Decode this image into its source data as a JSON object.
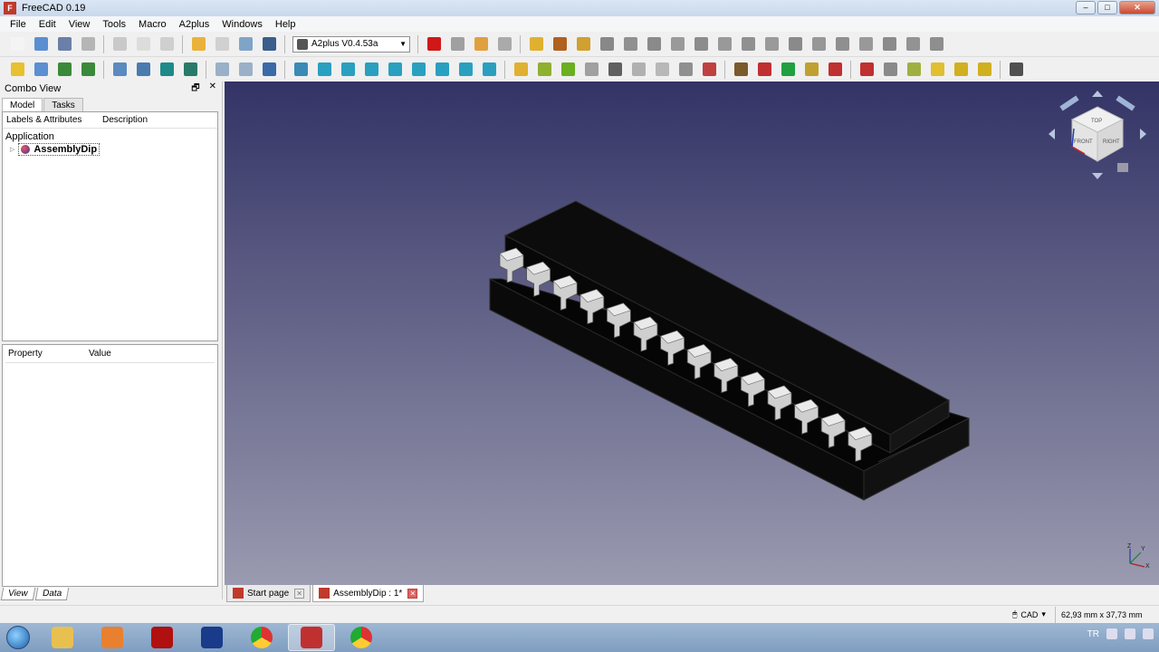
{
  "window": {
    "title": "FreeCAD 0.19",
    "min": "–",
    "max": "□",
    "close": "✕"
  },
  "menu": [
    "File",
    "Edit",
    "View",
    "Tools",
    "Macro",
    "A2plus",
    "Windows",
    "Help"
  ],
  "workbench_selector": {
    "value": "A2plus V0.4.53a"
  },
  "toolbar1_icons": [
    {
      "name": "new-document-icon",
      "color": "#f4f4f4"
    },
    {
      "name": "open-icon",
      "color": "#5b8fd1"
    },
    {
      "name": "save-icon",
      "color": "#6b7fa8"
    },
    {
      "name": "print-icon",
      "color": "#b5b5b5"
    },
    {
      "sep": true
    },
    {
      "name": "cut-icon",
      "color": "#c9c9c9"
    },
    {
      "name": "copy-icon",
      "color": "#dcdcdc"
    },
    {
      "name": "paste-icon",
      "color": "#cfcfcf"
    },
    {
      "sep": true
    },
    {
      "name": "undo-icon",
      "color": "#e9b23a"
    },
    {
      "name": "redo-icon",
      "color": "#d0d0d0"
    },
    {
      "name": "refresh-icon",
      "color": "#7fa4c8"
    },
    {
      "name": "whats-this-icon",
      "color": "#3a5d8a"
    },
    {
      "sep": true
    },
    {
      "wb": true
    },
    {
      "sep": true
    },
    {
      "name": "macro-record-icon",
      "color": "#d01818"
    },
    {
      "name": "macro-stop-icon",
      "color": "#a0a0a0"
    },
    {
      "name": "macro-edit-icon",
      "color": "#e0a040"
    },
    {
      "name": "macro-run-icon",
      "color": "#aaaaaa"
    },
    {
      "sep": true
    },
    {
      "name": "a2p-add-part-icon",
      "color": "#e0b030"
    },
    {
      "name": "a2p-import-icon",
      "color": "#b06020"
    },
    {
      "name": "a2p-shape-icon",
      "color": "#d0a030"
    },
    {
      "name": "a2p-delete-icon",
      "color": "#888888"
    },
    {
      "name": "point-constraint-icon",
      "color": "#909090"
    },
    {
      "name": "point-on-line-icon",
      "color": "#8a8a8a"
    },
    {
      "name": "point-on-plane-icon",
      "color": "#9a9a9a"
    },
    {
      "name": "sphere-constraint-icon",
      "color": "#8c8c8c"
    },
    {
      "name": "circular-edge-icon",
      "color": "#999999"
    },
    {
      "name": "axial-constraint-icon",
      "color": "#909090"
    },
    {
      "name": "axis-parallel-icon",
      "color": "#9a9a9a"
    },
    {
      "name": "angled-planes-icon",
      "color": "#8a8a8a"
    },
    {
      "name": "plane-parallel-icon",
      "color": "#979797"
    },
    {
      "name": "plane-coincident-icon",
      "color": "#8f8f8f"
    },
    {
      "name": "angle-constraint-icon",
      "color": "#999999"
    },
    {
      "name": "center-of-mass-icon",
      "color": "#8b8b8b"
    },
    {
      "name": "lock-constraint-icon",
      "color": "#939393"
    },
    {
      "name": "edit-constraint-icon",
      "color": "#8e8e8e"
    }
  ],
  "toolbar2_icons": [
    {
      "name": "part-yellow-icon",
      "color": "#e8c030"
    },
    {
      "name": "folder-icon",
      "color": "#5b8fd1"
    },
    {
      "name": "link-icon",
      "color": "#3a8a3a"
    },
    {
      "name": "link-group-icon",
      "color": "#3a8a3a"
    },
    {
      "sep": true
    },
    {
      "name": "fit-all-icon",
      "color": "#5a8ac0"
    },
    {
      "name": "fit-selection-icon",
      "color": "#4a7ab0"
    },
    {
      "name": "draw-style-icon",
      "color": "#1f8a8a"
    },
    {
      "name": "bounding-box-icon",
      "color": "#2a7a6a"
    },
    {
      "sep": true
    },
    {
      "name": "back-icon",
      "color": "#9ab0c8"
    },
    {
      "name": "forward-icon",
      "color": "#9ab0c8"
    },
    {
      "name": "std-view-icon",
      "color": "#3a6aa8"
    },
    {
      "sep": true
    },
    {
      "name": "zoom-box-icon",
      "color": "#3a8ab8"
    },
    {
      "name": "isometric-icon",
      "color": "#2aa0c0"
    },
    {
      "name": "front-view-icon",
      "color": "#2aa0c0"
    },
    {
      "name": "top-view-icon",
      "color": "#2aa0c0"
    },
    {
      "name": "right-view-icon",
      "color": "#2aa0c0"
    },
    {
      "name": "rear-view-icon",
      "color": "#2aa0c0"
    },
    {
      "name": "bottom-view-icon",
      "color": "#2aa0c0"
    },
    {
      "name": "left-view-icon",
      "color": "#2aa0c0"
    },
    {
      "name": "measure-icon",
      "color": "#2aa0c0"
    },
    {
      "sep": true
    },
    {
      "name": "a2p-solve-icon",
      "color": "#e0b030"
    },
    {
      "name": "a2p-update-icon",
      "color": "#90b030"
    },
    {
      "name": "a2p-recompute-icon",
      "color": "#6ab020"
    },
    {
      "name": "a2p-move-icon",
      "color": "#a0a0a0"
    },
    {
      "name": "a2p-duplicate-icon",
      "color": "#606060"
    },
    {
      "name": "a2p-convert-icon",
      "color": "#b0b0b0"
    },
    {
      "name": "a2p-transparency-icon",
      "color": "#b8b8b8"
    },
    {
      "name": "a2p-partlist-icon",
      "color": "#909090"
    },
    {
      "name": "a2p-export-icon",
      "color": "#c04040"
    },
    {
      "sep": true
    },
    {
      "name": "a2p-mirror-icon",
      "color": "#7a5a2a"
    },
    {
      "name": "a2p-autosolve-icon",
      "color": "#c03030"
    },
    {
      "name": "a2p-flip-icon",
      "color": "#20a040"
    },
    {
      "name": "a2p-list-icon",
      "color": "#c0a030"
    },
    {
      "name": "a2p-tools-icon",
      "color": "#c03030"
    },
    {
      "sep": true
    },
    {
      "name": "a2p-cleanup-icon",
      "color": "#c03030"
    },
    {
      "name": "a2p-search-icon",
      "color": "#8a8a8a"
    },
    {
      "name": "a2p-bom-icon",
      "color": "#a0b040"
    },
    {
      "name": "a2p-cd-icon",
      "color": "#e0c030"
    },
    {
      "name": "a2p-label-icon",
      "color": "#d0b020"
    },
    {
      "name": "a2p-shape-ref-icon",
      "color": "#d0b020"
    },
    {
      "sep": true
    },
    {
      "name": "a2p-debug-icon",
      "color": "#505050"
    }
  ],
  "combo_view": {
    "title": "Combo View",
    "float_btn": "🗗",
    "close_btn": "✕",
    "tabs": [
      "Model",
      "Tasks"
    ],
    "tree_columns": [
      "Labels & Attributes",
      "Description"
    ],
    "tree_root": "Application",
    "tree_item": "AssemblyDip",
    "prop_columns": [
      "Property",
      "Value"
    ],
    "bottom_tabs": [
      "View",
      "Data"
    ]
  },
  "navcube": {
    "faces": [
      "TOP",
      "FRONT",
      "RIGHT"
    ]
  },
  "axis": {
    "x": "X",
    "y": "Y",
    "z": "Z"
  },
  "doc_tabs": [
    {
      "label": "Start page"
    },
    {
      "label": "AssemblyDip : 1*"
    }
  ],
  "status": {
    "nav_mode": "CAD",
    "dims": "62,93 mm x 37,73 mm"
  },
  "taskbar": {
    "apps": [
      {
        "name": "explorer-icon",
        "color": "#e8c050"
      },
      {
        "name": "media-player-icon",
        "color": "#e88030"
      },
      {
        "name": "sketch-app-icon",
        "color": "#b01010"
      },
      {
        "name": "ccleaner-icon",
        "color": "#1a3a8a"
      },
      {
        "name": "chrome-icon",
        "color": "#2c9a3a"
      },
      {
        "name": "freecad-task-icon",
        "color": "#c03030"
      },
      {
        "name": "chrome-profile-icon",
        "color": "#d04040"
      }
    ],
    "lang": "TR"
  }
}
